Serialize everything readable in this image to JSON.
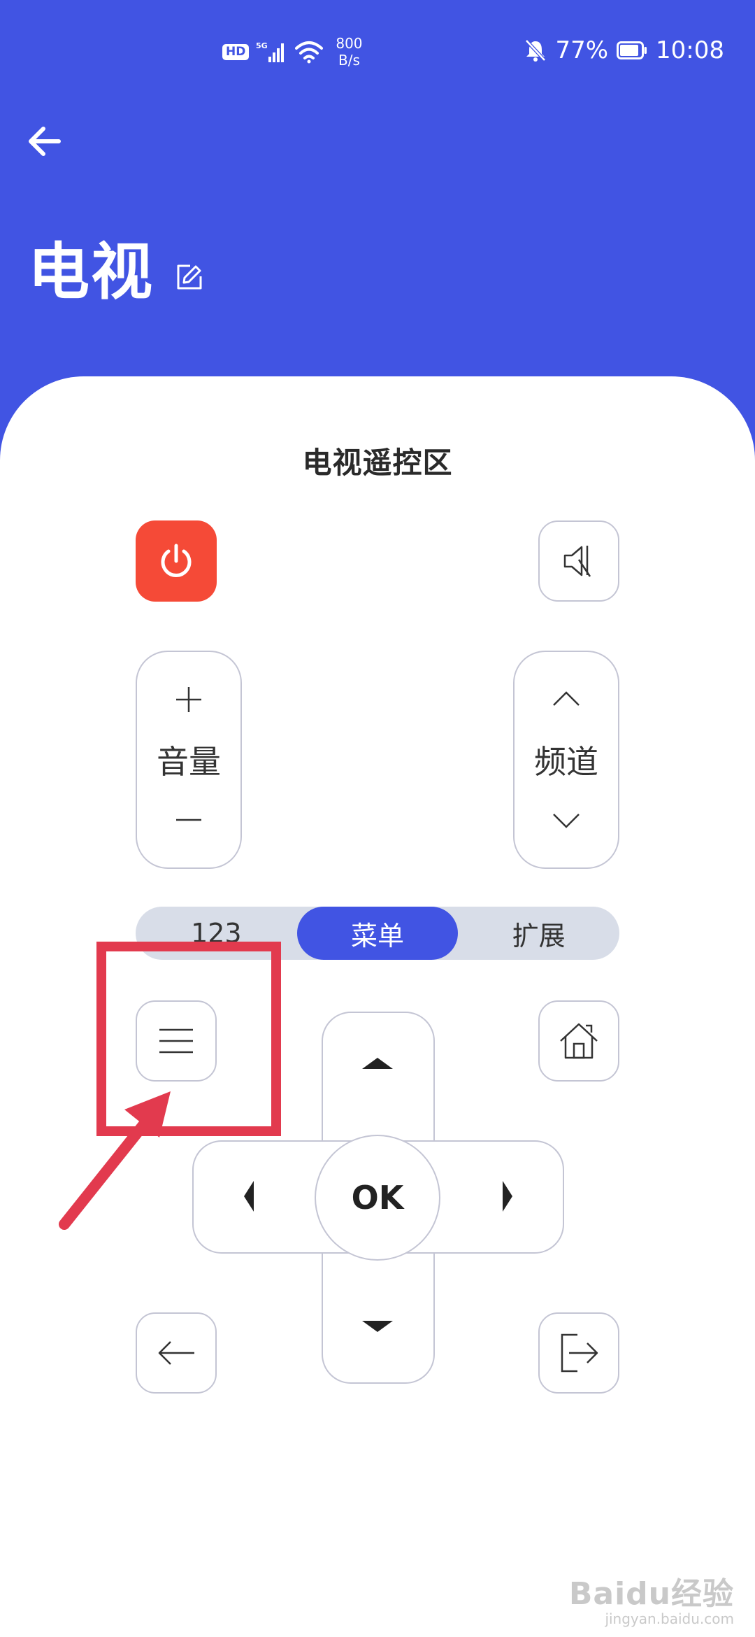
{
  "status_bar": {
    "hd": "HD",
    "net_speed_value": "800",
    "net_speed_unit": "B/s",
    "battery": "77%",
    "time": "10:08"
  },
  "header": {
    "title": "电视"
  },
  "remote": {
    "section_title": "电视遥控区",
    "volume_label": "音量",
    "channel_label": "频道",
    "tabs": [
      {
        "label": "123",
        "active": false
      },
      {
        "label": "菜单",
        "active": true
      },
      {
        "label": "扩展",
        "active": false
      }
    ],
    "ok_label": "OK"
  },
  "watermark": {
    "main": "Baidu经验",
    "sub": "jingyan.baidu.com"
  },
  "colors": {
    "header_bg": "#4154e3",
    "power": "#f54a37",
    "annotation": "#e23a4e",
    "tab_active": "#4154e3"
  }
}
